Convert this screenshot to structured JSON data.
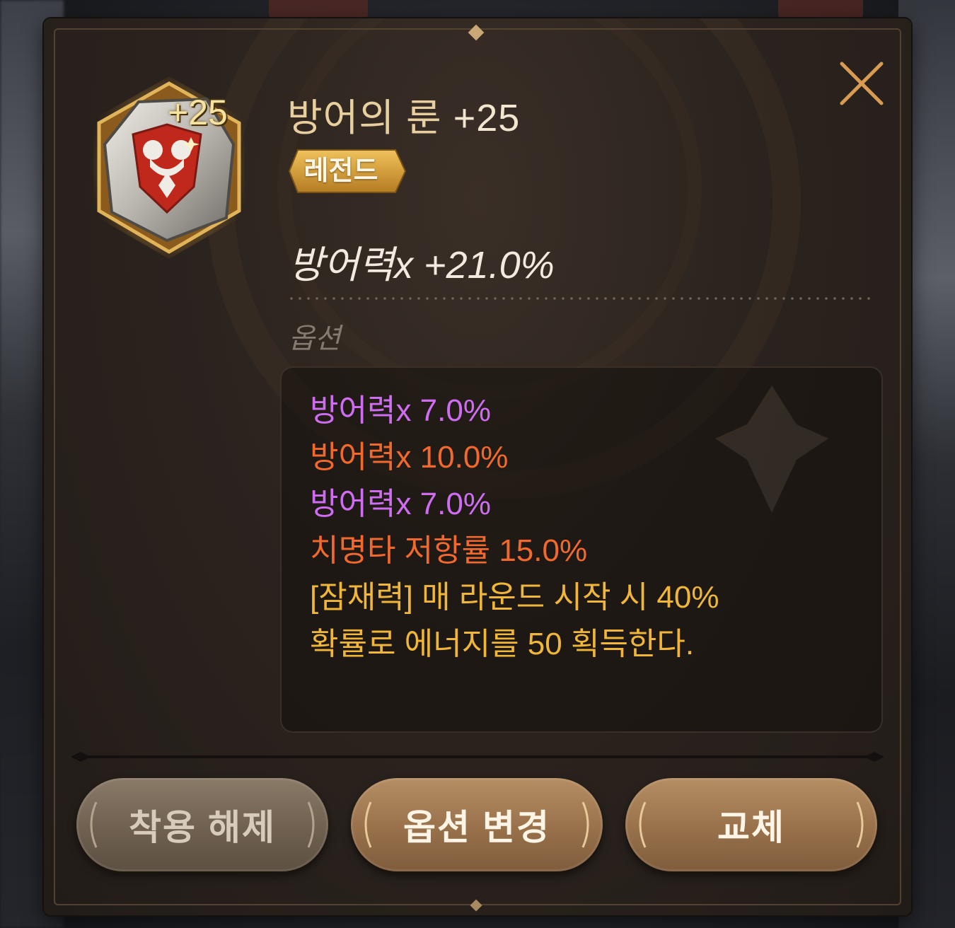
{
  "item": {
    "name": "방어의 룬",
    "level_label": "+25",
    "grade": "레전드",
    "main_stat": "방어력x +21.0%"
  },
  "options": {
    "header": "옵션",
    "lines": [
      {
        "text": "방어력x 7.0%",
        "color": "#cf6df2"
      },
      {
        "text": "방어력x 10.0%",
        "color": "#f2682d"
      },
      {
        "text": "방어력x 7.0%",
        "color": "#cf6df2"
      },
      {
        "text": "치명타 저항률 15.0%",
        "color": "#f2682d"
      },
      {
        "text": "[잠재력] 매 라운드 시작 시 40%",
        "color": "#f0b63a"
      },
      {
        "text": "확률로 에너지를 50 획득한다.",
        "color": "#f0b63a"
      }
    ]
  },
  "buttons": {
    "unequip": "착용 해제",
    "change_option": "옵션 변경",
    "replace": "교체"
  },
  "icons": {
    "close": "close-icon",
    "rune": "defense-rune-icon"
  },
  "colors": {
    "title": "#e8cfa0",
    "grade_badge": "#d9a23c",
    "rune_shield": "#c0281c"
  }
}
